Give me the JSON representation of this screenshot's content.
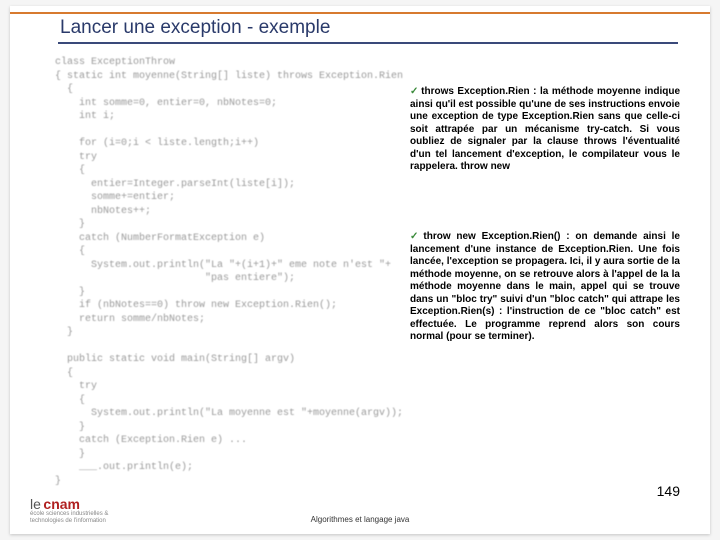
{
  "title": "Lancer une exception - exemple",
  "code": "class ExceptionThrow\n{ static int moyenne(String[] liste) throws Exception.Rien\n  {\n    int somme=0, entier=0, nbNotes=0;\n    int i;\n\n    for (i=0;i < liste.length;i++)\n    try\n    {\n      entier=Integer.parseInt(liste[i]);\n      somme+=entier;\n      nbNotes++;\n    }\n    catch (NumberFormatException e)\n    {\n      System.out.println(\"La \"+(i+1)+\" eme note n'est \"+\n                         \"pas entiere\");\n    }\n    if (nbNotes==0) throw new Exception.Rien();\n    return somme/nbNotes;\n  }\n\n  public static void main(String[] argv)\n  {\n    try\n    {\n      System.out.println(\"La moyenne est \"+moyenne(argv));\n    }\n    catch (Exception.Rien e) ...\n    }\n    ___.out.println(e);\n}",
  "para1": {
    "lead": "throws Exception.Rien",
    "body": " : la méthode moyenne indique ainsi qu'il est possible qu'une de ses instructions envoie une exception de type Exception.Rien sans que celle-ci soit attrapée par un mécanisme try-catch. Si vous oubliez de signaler par la clause throws l'éventualité d'un tel lancement d'exception, le compilateur vous le rappelera. throw new"
  },
  "para2": {
    "lead": "throw new Exception.Rien()",
    "body": " : on demande ainsi le lancement d'une instance de Exception.Rien. Une fois lancée, l'exception se propagera. Ici, il y aura sortie de la méthode moyenne, on se retrouve alors à l'appel de la la méthode moyenne dans le main, appel qui se trouve dans un \"bloc try\" suivi d'un \"bloc catch\" qui attrape les Exception.Rien(s) : l'instruction de ce \"bloc catch\" est effectuée. Le programme reprend alors son cours normal (pour se terminer)."
  },
  "logo": {
    "le": "le",
    "cnam": "cnam",
    "sub1": "école sciences industrielles &",
    "sub2": "technologies de l'information"
  },
  "footer": "Algorithmes et langage java",
  "pagenum": "149",
  "checkmark": "✓"
}
